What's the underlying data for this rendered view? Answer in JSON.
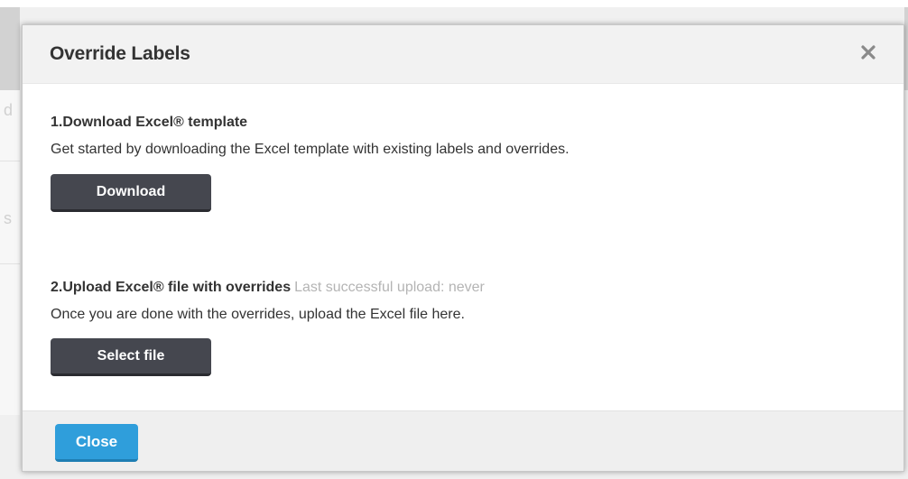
{
  "background": {
    "glyph_1": "d",
    "glyph_2": "s"
  },
  "dialog": {
    "title": "Override Labels",
    "close_icon": "close-icon",
    "step1": {
      "title": "1.Download Excel® template",
      "description": "Get started by downloading the Excel template with existing labels and overrides.",
      "button_label": "Download"
    },
    "step2": {
      "title": "2.Upload Excel® file with overrides",
      "note": "Last successful upload: never",
      "description": "Once you are done with the overrides, upload the Excel file here.",
      "button_label": "Select file"
    },
    "footer": {
      "close_label": "Close"
    }
  },
  "colors": {
    "dark_button": "#45474f",
    "primary_button": "#2f9edb",
    "muted_text": "#b4b4b4",
    "title_text": "#333333"
  }
}
